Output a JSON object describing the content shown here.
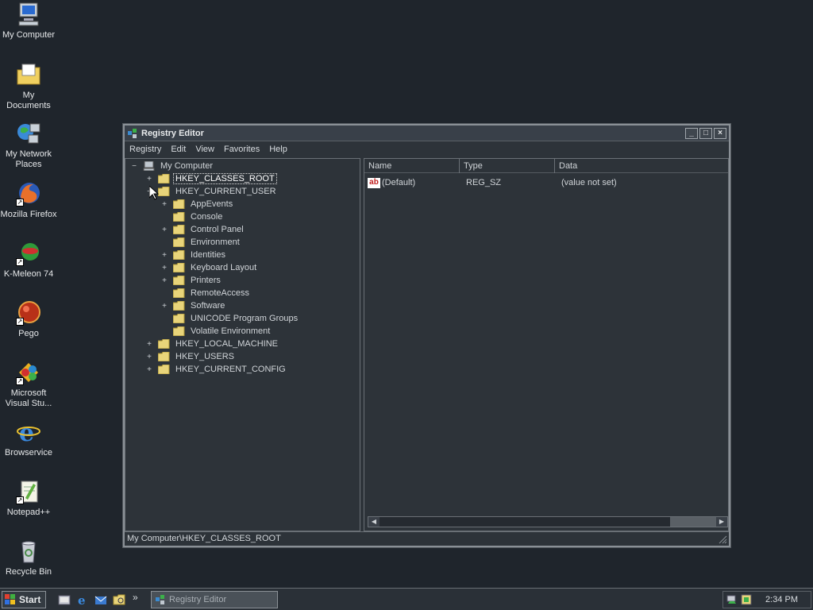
{
  "desktop": {
    "icons": [
      {
        "label": "My Computer"
      },
      {
        "label": "My Documents"
      },
      {
        "label": "My Network Places"
      },
      {
        "label": "Mozilla Firefox"
      },
      {
        "label": "K-Meleon 74"
      },
      {
        "label": "Pego"
      },
      {
        "label": "Microsoft Visual Stu..."
      },
      {
        "label": "Browservice"
      },
      {
        "label": "Notepad++"
      },
      {
        "label": "Recycle Bin"
      }
    ]
  },
  "window": {
    "title": "Registry Editor",
    "menu": [
      "Registry",
      "Edit",
      "View",
      "Favorites",
      "Help"
    ],
    "tree": {
      "root": "My Computer",
      "root_expander": "−",
      "nodes": [
        {
          "label": "HKEY_CLASSES_ROOT",
          "expander": "+"
        },
        {
          "label": "HKEY_CURRENT_USER",
          "expander": "−"
        },
        {
          "label": "AppEvents",
          "expander": "+"
        },
        {
          "label": "Console",
          "expander": ""
        },
        {
          "label": "Control Panel",
          "expander": "+"
        },
        {
          "label": "Environment",
          "expander": ""
        },
        {
          "label": "Identities",
          "expander": "+"
        },
        {
          "label": "Keyboard Layout",
          "expander": "+"
        },
        {
          "label": "Printers",
          "expander": "+"
        },
        {
          "label": "RemoteAccess",
          "expander": ""
        },
        {
          "label": "Software",
          "expander": "+"
        },
        {
          "label": "UNICODE Program Groups",
          "expander": ""
        },
        {
          "label": "Volatile Environment",
          "expander": ""
        },
        {
          "label": "HKEY_LOCAL_MACHINE",
          "expander": "+"
        },
        {
          "label": "HKEY_USERS",
          "expander": "+"
        },
        {
          "label": "HKEY_CURRENT_CONFIG",
          "expander": "+"
        }
      ]
    },
    "columns": [
      "Name",
      "Type",
      "Data"
    ],
    "values": [
      {
        "name": "(Default)",
        "type": "REG_SZ",
        "data": "(value not set)",
        "icon_text": "ab"
      }
    ],
    "status": "My Computer\\HKEY_CLASSES_ROOT"
  },
  "taskbar": {
    "start_label": "Start",
    "chevron": "»",
    "task": "Registry Editor",
    "clock": "2:34 PM"
  },
  "colors": {
    "desktop": "#1f252c",
    "window": "#2d3339",
    "folder": "#e8d47a",
    "selection_outline": "#e0e0e0"
  }
}
